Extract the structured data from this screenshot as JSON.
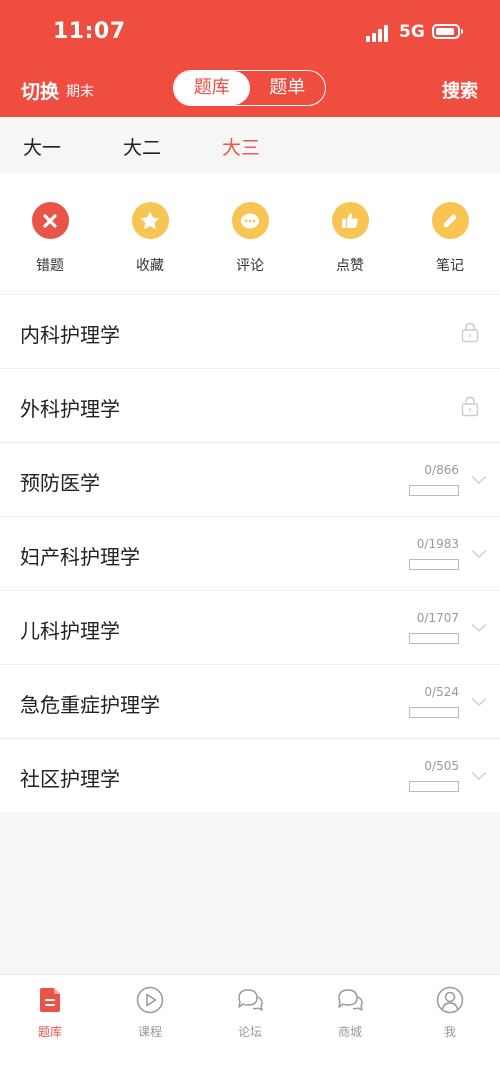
{
  "status_bar": {
    "time": "11:07",
    "network": "5G"
  },
  "navbar": {
    "switch_label": "切换",
    "term_label": "期末",
    "segments": [
      {
        "label": "题库",
        "active": true
      },
      {
        "label": "题单",
        "active": false
      }
    ],
    "search_label": "搜索"
  },
  "grades": [
    {
      "label": "大一",
      "active": false
    },
    {
      "label": "大二",
      "active": false
    },
    {
      "label": "大三",
      "active": true
    }
  ],
  "quick_actions": [
    {
      "label": "错题",
      "icon": "close-icon",
      "color": "#e85548"
    },
    {
      "label": "收藏",
      "icon": "star-icon",
      "color": "#f8c452"
    },
    {
      "label": "评论",
      "icon": "comment-icon",
      "color": "#f8c452"
    },
    {
      "label": "点赞",
      "icon": "thumbs-up-icon",
      "color": "#f8c452"
    },
    {
      "label": "笔记",
      "icon": "pencil-icon",
      "color": "#f8c452"
    }
  ],
  "courses": [
    {
      "name": "内科护理学",
      "locked": true
    },
    {
      "name": "外科护理学",
      "locked": true
    },
    {
      "name": "预防医学",
      "locked": false,
      "progress": "0/866",
      "done": 0,
      "total": 866
    },
    {
      "name": "妇产科护理学",
      "locked": false,
      "progress": "0/1983",
      "done": 0,
      "total": 1983
    },
    {
      "name": "儿科护理学",
      "locked": false,
      "progress": "0/1707",
      "done": 0,
      "total": 1707
    },
    {
      "name": "急危重症护理学",
      "locked": false,
      "progress": "0/524",
      "done": 0,
      "total": 524
    },
    {
      "name": "社区护理学",
      "locked": false,
      "progress": "0/505",
      "done": 0,
      "total": 505
    }
  ],
  "tabbar": [
    {
      "label": "题库",
      "icon": "question-bank-icon",
      "active": true
    },
    {
      "label": "课程",
      "icon": "play-icon",
      "active": false
    },
    {
      "label": "论坛",
      "icon": "forum-icon",
      "active": false
    },
    {
      "label": "商城",
      "icon": "shop-chat-icon",
      "active": false
    },
    {
      "label": "我",
      "icon": "profile-icon",
      "active": false
    }
  ],
  "colors": {
    "brand": "#ee4d40",
    "accent": "#e85548",
    "yellow": "#f8c452"
  }
}
